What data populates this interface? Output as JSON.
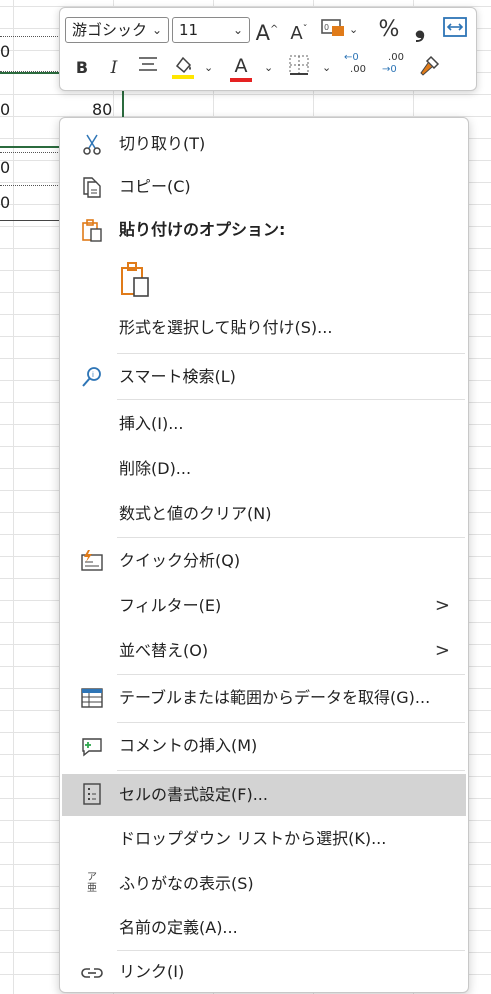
{
  "sheet": {
    "cells": [
      "0",
      "0",
      "0",
      "0",
      "0"
    ],
    "selected_value": "80"
  },
  "toolbar": {
    "font_name": "游ゴシック",
    "font_size": "11",
    "increase_font": "A",
    "decrease_font": "A",
    "percent": "%",
    "comma": "❟",
    "bold": "B",
    "italic": "I",
    "font_color_letter": "A",
    "dec_more": ".00",
    "dec_less": ".00"
  },
  "menu": {
    "cut": "切り取り(T)",
    "copy": "コピー(C)",
    "paste_options": "貼り付けのオプション:",
    "paste_special": "形式を選択して貼り付け(S)...",
    "smart_lookup": "スマート検索(L)",
    "insert": "挿入(I)...",
    "delete": "削除(D)...",
    "clear": "数式と値のクリア(N)",
    "quick_analysis": "クイック分析(Q)",
    "filter": "フィルター(E)",
    "sort": "並べ替え(O)",
    "get_data": "テーブルまたは範囲からデータを取得(G)...",
    "insert_comment": "コメントの挿入(M)",
    "format_cells": "セルの書式設定(F)...",
    "dropdown_pick": "ドロップダウン リストから選択(K)...",
    "show_phonetic": "ふりがなの表示(S)",
    "define_name": "名前の定義(A)...",
    "link": "リンク(I)",
    "submenu_arrow": ">",
    "phonetic_icon_top": "ア",
    "phonetic_icon_bottom": "亜"
  },
  "colors": {
    "accent_orange": "#e07b19",
    "accent_blue": "#2e75b6",
    "highlight_yellow": "#ffe600",
    "font_red": "#e52222",
    "selection_green": "#2b6b3e",
    "menu_highlight": "#d3d3d3"
  }
}
